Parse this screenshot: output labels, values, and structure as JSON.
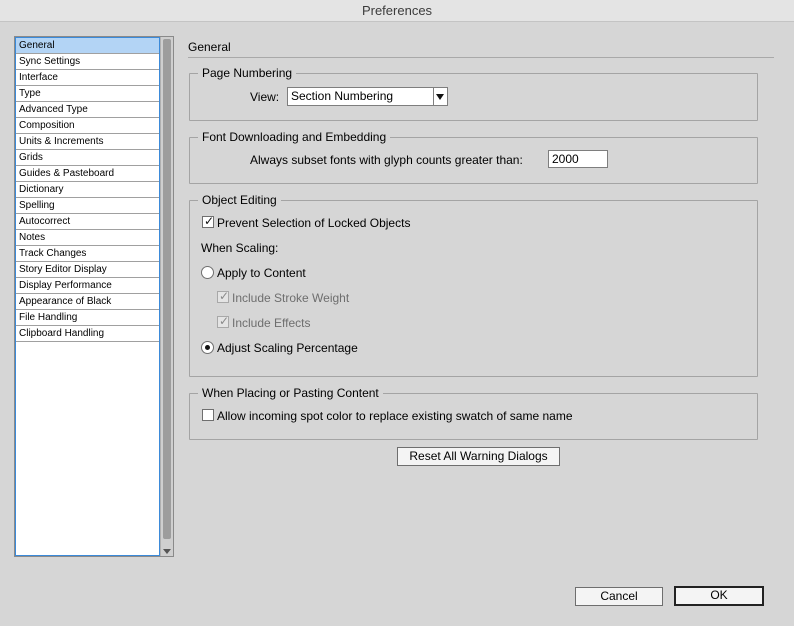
{
  "window": {
    "title": "Preferences"
  },
  "sidebar": {
    "items": [
      {
        "label": "General",
        "selected": true
      },
      {
        "label": "Sync Settings"
      },
      {
        "label": "Interface"
      },
      {
        "label": "Type"
      },
      {
        "label": "Advanced Type"
      },
      {
        "label": "Composition"
      },
      {
        "label": "Units & Increments"
      },
      {
        "label": "Grids"
      },
      {
        "label": "Guides & Pasteboard"
      },
      {
        "label": "Dictionary"
      },
      {
        "label": "Spelling"
      },
      {
        "label": "Autocorrect"
      },
      {
        "label": "Notes"
      },
      {
        "label": "Track Changes"
      },
      {
        "label": "Story Editor Display"
      },
      {
        "label": "Display Performance"
      },
      {
        "label": "Appearance of Black"
      },
      {
        "label": "File Handling"
      },
      {
        "label": "Clipboard Handling"
      }
    ]
  },
  "main": {
    "section_title": "General",
    "page_numbering": {
      "legend": "Page Numbering",
      "view_label": "View:",
      "view_value": "Section Numbering"
    },
    "font_downloading": {
      "legend": "Font Downloading and Embedding",
      "subset_label": "Always subset fonts with glyph counts greater than:",
      "subset_value": "2000"
    },
    "object_editing": {
      "legend": "Object Editing",
      "prevent_selection_label": "Prevent Selection of Locked Objects",
      "prevent_selection_checked": true,
      "when_scaling_label": "When Scaling:",
      "apply_to_content_label": "Apply to Content",
      "include_stroke_label": "Include Stroke Weight",
      "include_effects_label": "Include Effects",
      "adjust_scaling_label": "Adjust Scaling Percentage",
      "selected_scaling_option": "Adjust Scaling Percentage"
    },
    "placing": {
      "legend": "When Placing or Pasting Content",
      "spot_color_label": "Allow incoming spot color to replace existing swatch of same name",
      "spot_color_checked": false
    },
    "reset_warning_label": "Reset All Warning Dialogs"
  },
  "footer": {
    "cancel_label": "Cancel",
    "ok_label": "OK"
  }
}
